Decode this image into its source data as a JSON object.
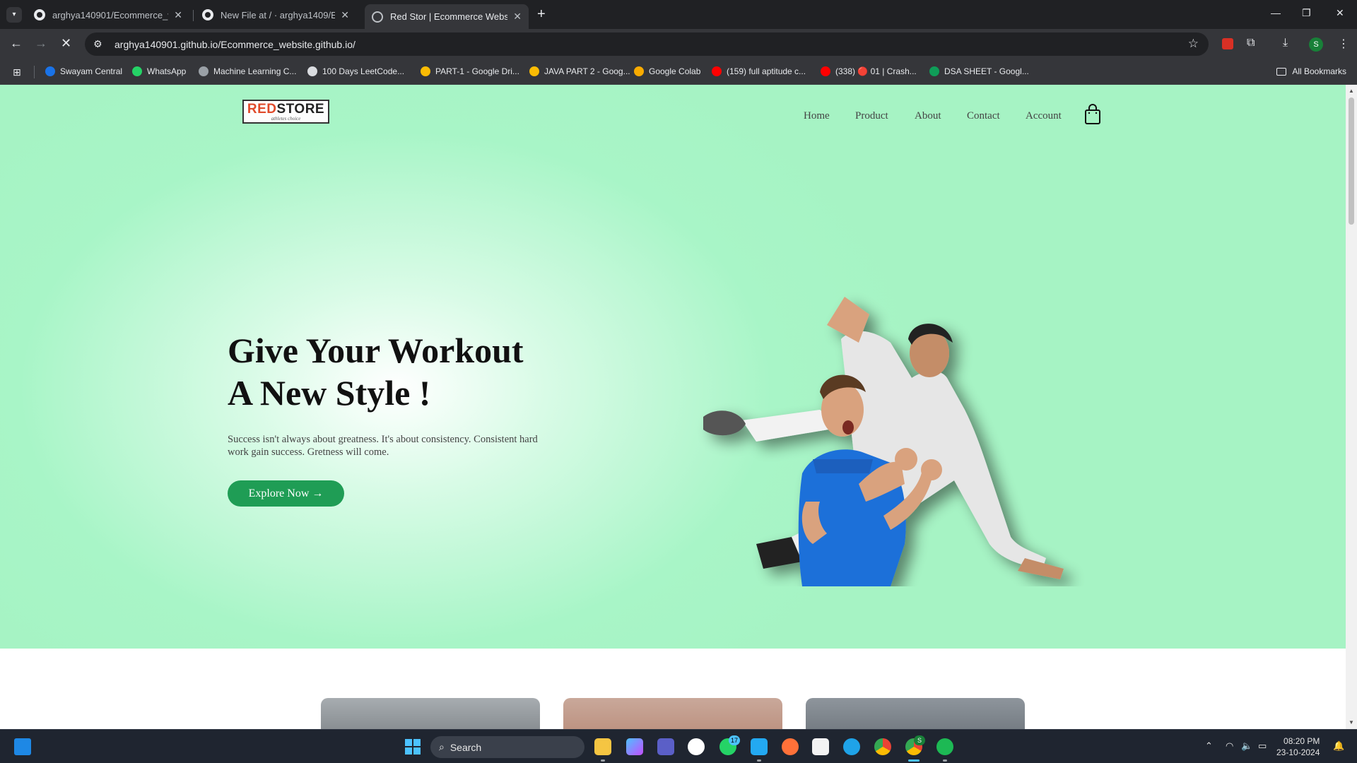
{
  "browser": {
    "tabs": [
      {
        "title": "arghya140901/Ecommerce_website",
        "active": false
      },
      {
        "title": "New File at / · arghya1409/Ecommerce",
        "active": false
      },
      {
        "title": "Red Stor | Ecommerce Website",
        "active": true
      }
    ],
    "url": "arghya140901.github.io/Ecommerce_website.github.io/",
    "profile_initial": "S",
    "bookmarks": [
      {
        "label": "Swayam Central",
        "color": "#1a73e8"
      },
      {
        "label": "WhatsApp",
        "color": "#25d366"
      },
      {
        "label": "Machine Learning C...",
        "color": "#9aa0a6"
      },
      {
        "label": "100 Days LeetCode...",
        "color": "#dadce0"
      },
      {
        "label": "PART-1 - Google Dri...",
        "color": "#fbbc04"
      },
      {
        "label": "JAVA PART 2 - Goog...",
        "color": "#fbbc04"
      },
      {
        "label": "Google Colab",
        "color": "#f9ab00"
      },
      {
        "label": "(159) full aptitude c...",
        "color": "#ff0000"
      },
      {
        "label": "(338) 🔴 01 | Crash...",
        "color": "#ff0000"
      },
      {
        "label": "DSA SHEET - Googl...",
        "color": "#0f9d58"
      }
    ],
    "all_bookmarks_label": "All Bookmarks"
  },
  "site": {
    "logo": {
      "red": "RED",
      "dark": "STORE",
      "tagline": "athletes choice"
    },
    "nav": [
      "Home",
      "Product",
      "About",
      "Contact",
      "Account"
    ],
    "hero": {
      "headline_line1": "Give Your Workout",
      "headline_line2": "A New Style !",
      "subtext": "Success isn't always about greatness. It's about consistency. Consistent hard work gain success. Gretness will come.",
      "cta_label": "Explore Now →"
    },
    "colors": {
      "hero_bg": "#a6f3c4",
      "cta": "#1f9d55",
      "logo_red": "#e04a2a"
    }
  },
  "taskbar": {
    "search_placeholder": "Search",
    "whatsapp_badge": "17",
    "chrome_badge": "S",
    "time": "08:20 PM",
    "date": "23-10-2024"
  }
}
